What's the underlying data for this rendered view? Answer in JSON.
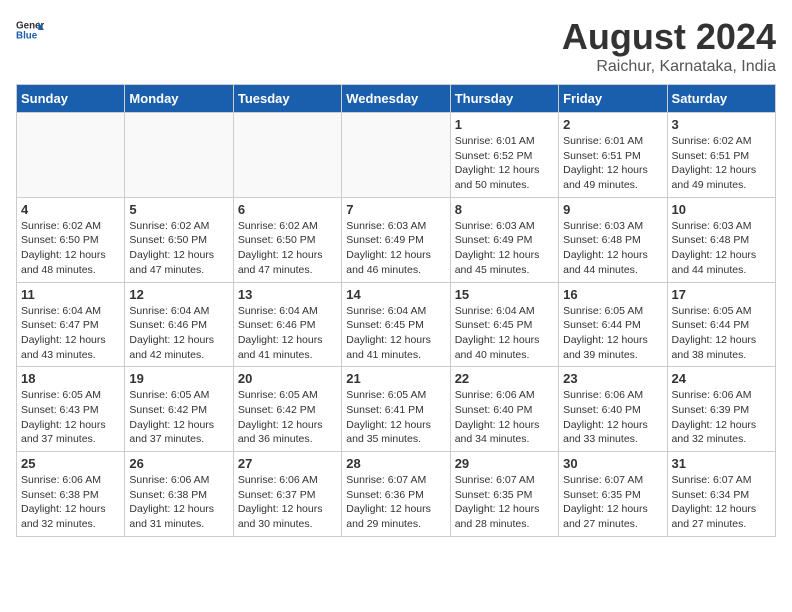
{
  "header": {
    "logo_general": "General",
    "logo_blue": "Blue",
    "month": "August 2024",
    "location": "Raichur, Karnataka, India"
  },
  "weekdays": [
    "Sunday",
    "Monday",
    "Tuesday",
    "Wednesday",
    "Thursday",
    "Friday",
    "Saturday"
  ],
  "weeks": [
    [
      {
        "day": "",
        "info": ""
      },
      {
        "day": "",
        "info": ""
      },
      {
        "day": "",
        "info": ""
      },
      {
        "day": "",
        "info": ""
      },
      {
        "day": "1",
        "info": "Sunrise: 6:01 AM\nSunset: 6:52 PM\nDaylight: 12 hours\nand 50 minutes."
      },
      {
        "day": "2",
        "info": "Sunrise: 6:01 AM\nSunset: 6:51 PM\nDaylight: 12 hours\nand 49 minutes."
      },
      {
        "day": "3",
        "info": "Sunrise: 6:02 AM\nSunset: 6:51 PM\nDaylight: 12 hours\nand 49 minutes."
      }
    ],
    [
      {
        "day": "4",
        "info": "Sunrise: 6:02 AM\nSunset: 6:50 PM\nDaylight: 12 hours\nand 48 minutes."
      },
      {
        "day": "5",
        "info": "Sunrise: 6:02 AM\nSunset: 6:50 PM\nDaylight: 12 hours\nand 47 minutes."
      },
      {
        "day": "6",
        "info": "Sunrise: 6:02 AM\nSunset: 6:50 PM\nDaylight: 12 hours\nand 47 minutes."
      },
      {
        "day": "7",
        "info": "Sunrise: 6:03 AM\nSunset: 6:49 PM\nDaylight: 12 hours\nand 46 minutes."
      },
      {
        "day": "8",
        "info": "Sunrise: 6:03 AM\nSunset: 6:49 PM\nDaylight: 12 hours\nand 45 minutes."
      },
      {
        "day": "9",
        "info": "Sunrise: 6:03 AM\nSunset: 6:48 PM\nDaylight: 12 hours\nand 44 minutes."
      },
      {
        "day": "10",
        "info": "Sunrise: 6:03 AM\nSunset: 6:48 PM\nDaylight: 12 hours\nand 44 minutes."
      }
    ],
    [
      {
        "day": "11",
        "info": "Sunrise: 6:04 AM\nSunset: 6:47 PM\nDaylight: 12 hours\nand 43 minutes."
      },
      {
        "day": "12",
        "info": "Sunrise: 6:04 AM\nSunset: 6:46 PM\nDaylight: 12 hours\nand 42 minutes."
      },
      {
        "day": "13",
        "info": "Sunrise: 6:04 AM\nSunset: 6:46 PM\nDaylight: 12 hours\nand 41 minutes."
      },
      {
        "day": "14",
        "info": "Sunrise: 6:04 AM\nSunset: 6:45 PM\nDaylight: 12 hours\nand 41 minutes."
      },
      {
        "day": "15",
        "info": "Sunrise: 6:04 AM\nSunset: 6:45 PM\nDaylight: 12 hours\nand 40 minutes."
      },
      {
        "day": "16",
        "info": "Sunrise: 6:05 AM\nSunset: 6:44 PM\nDaylight: 12 hours\nand 39 minutes."
      },
      {
        "day": "17",
        "info": "Sunrise: 6:05 AM\nSunset: 6:44 PM\nDaylight: 12 hours\nand 38 minutes."
      }
    ],
    [
      {
        "day": "18",
        "info": "Sunrise: 6:05 AM\nSunset: 6:43 PM\nDaylight: 12 hours\nand 37 minutes."
      },
      {
        "day": "19",
        "info": "Sunrise: 6:05 AM\nSunset: 6:42 PM\nDaylight: 12 hours\nand 37 minutes."
      },
      {
        "day": "20",
        "info": "Sunrise: 6:05 AM\nSunset: 6:42 PM\nDaylight: 12 hours\nand 36 minutes."
      },
      {
        "day": "21",
        "info": "Sunrise: 6:05 AM\nSunset: 6:41 PM\nDaylight: 12 hours\nand 35 minutes."
      },
      {
        "day": "22",
        "info": "Sunrise: 6:06 AM\nSunset: 6:40 PM\nDaylight: 12 hours\nand 34 minutes."
      },
      {
        "day": "23",
        "info": "Sunrise: 6:06 AM\nSunset: 6:40 PM\nDaylight: 12 hours\nand 33 minutes."
      },
      {
        "day": "24",
        "info": "Sunrise: 6:06 AM\nSunset: 6:39 PM\nDaylight: 12 hours\nand 32 minutes."
      }
    ],
    [
      {
        "day": "25",
        "info": "Sunrise: 6:06 AM\nSunset: 6:38 PM\nDaylight: 12 hours\nand 32 minutes."
      },
      {
        "day": "26",
        "info": "Sunrise: 6:06 AM\nSunset: 6:38 PM\nDaylight: 12 hours\nand 31 minutes."
      },
      {
        "day": "27",
        "info": "Sunrise: 6:06 AM\nSunset: 6:37 PM\nDaylight: 12 hours\nand 30 minutes."
      },
      {
        "day": "28",
        "info": "Sunrise: 6:07 AM\nSunset: 6:36 PM\nDaylight: 12 hours\nand 29 minutes."
      },
      {
        "day": "29",
        "info": "Sunrise: 6:07 AM\nSunset: 6:35 PM\nDaylight: 12 hours\nand 28 minutes."
      },
      {
        "day": "30",
        "info": "Sunrise: 6:07 AM\nSunset: 6:35 PM\nDaylight: 12 hours\nand 27 minutes."
      },
      {
        "day": "31",
        "info": "Sunrise: 6:07 AM\nSunset: 6:34 PM\nDaylight: 12 hours\nand 27 minutes."
      }
    ]
  ]
}
